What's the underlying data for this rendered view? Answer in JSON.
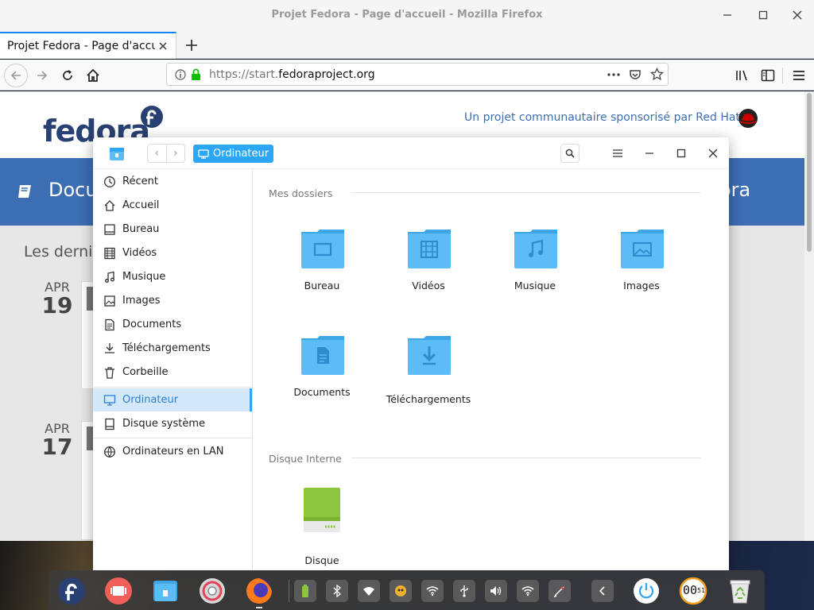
{
  "browser": {
    "window_title": "Projet Fedora - Page d'accueil - Mozilla Firefox",
    "tab_title": "Projet Fedora - Page d'accueil",
    "url_prefix": "https://start.",
    "url_host": "fedoraproject.org",
    "url_suffix": ".org"
  },
  "page": {
    "logo_text": "fedora",
    "sponsor_text": "Un projet communautaire sponsorisé par Red Hat",
    "banner_left": "Docu",
    "banner_right": "ora",
    "news_heading": "Les derniè",
    "posts": [
      {
        "month": "APR",
        "day": "19"
      },
      {
        "month": "APR",
        "day": "17"
      }
    ]
  },
  "file_manager": {
    "breadcrumb": "Ordinateur",
    "sidebar": {
      "items": [
        {
          "label": "Récent",
          "icon": "clock-icon"
        },
        {
          "label": "Accueil",
          "icon": "home-icon"
        },
        {
          "label": "Bureau",
          "icon": "desktop-icon"
        },
        {
          "label": "Vidéos",
          "icon": "film-icon"
        },
        {
          "label": "Musique",
          "icon": "music-icon"
        },
        {
          "label": "Images",
          "icon": "image-icon"
        },
        {
          "label": "Documents",
          "icon": "document-icon"
        },
        {
          "label": "Téléchargements",
          "icon": "download-icon"
        },
        {
          "label": "Corbeille",
          "icon": "trash-icon"
        }
      ],
      "computer": "Ordinateur",
      "system_disk": "Disque système",
      "lan": "Ordinateurs en LAN"
    },
    "sections": {
      "my_folders": "Mes dossiers",
      "internal_disk": "Disque Interne"
    },
    "folders": [
      {
        "label": "Bureau",
        "icon": "desktop-icon"
      },
      {
        "label": "Vidéos",
        "icon": "film-icon"
      },
      {
        "label": "Musique",
        "icon": "music-icon"
      },
      {
        "label": "Images",
        "icon": "image-icon"
      },
      {
        "label": "Documents",
        "icon": "document-icon"
      },
      {
        "label": "Téléchargements",
        "icon": "download-icon"
      }
    ],
    "drive_label": "Disque"
  },
  "dock": {
    "clock": "00",
    "clock_small": "51"
  },
  "colors": {
    "accent": "#2ca7f8",
    "folder": "#5cbcf5",
    "fedora_blue": "#3c6eb4",
    "drive_green": "#8cc63f"
  }
}
